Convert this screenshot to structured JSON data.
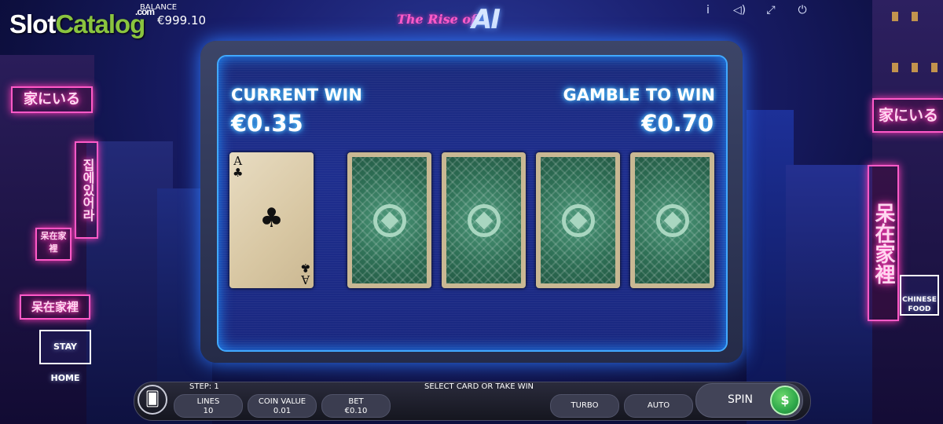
{
  "watermark": {
    "brand_slot": "Slot",
    "brand_catalog": "Catalog",
    "brand_com": ".com"
  },
  "balance": {
    "label": "BALANCE",
    "value": "€999.10"
  },
  "title": {
    "line1": "The Rise of",
    "line2": "AI"
  },
  "top_icons": [
    {
      "name": "info-icon",
      "glyph": "i"
    },
    {
      "name": "sound-icon",
      "glyph": "◁)"
    },
    {
      "name": "fullscreen-icon",
      "glyph": "⤢"
    },
    {
      "name": "power-icon",
      "glyph": "⏻"
    }
  ],
  "gamble": {
    "current_win_label": "CURRENT WIN",
    "current_win_value": "€0.35",
    "gamble_to_win_label": "GAMBLE TO WIN",
    "gamble_to_win_value": "€0.70",
    "cards": [
      {
        "state": "face-up",
        "rank": "A",
        "suit": "♣"
      },
      {
        "state": "face-down"
      },
      {
        "state": "face-down"
      },
      {
        "state": "face-down"
      },
      {
        "state": "face-down"
      }
    ]
  },
  "bottom_bar": {
    "step": "STEP: 1",
    "status": "SELECT CARD OR TAKE WIN",
    "lines_label": "LINES",
    "lines_value": "10",
    "coin_value_label": "COIN VALUE",
    "coin_value_value": "0.01",
    "bet_label": "BET",
    "bet_value": "€0.10",
    "turbo_label": "TURBO",
    "auto_label": "AUTO",
    "spin_label": "SPIN"
  },
  "signs": {
    "left_top": "家にいる",
    "left_vertical": "집에있어라",
    "left_small": "呆在家裡",
    "left_bottom": "呆在家裡",
    "stay_home": "STAY HOME",
    "right_top": "家にいる",
    "right_vertical": "呆在家裡",
    "chinese_food": "CHINESE FOOD"
  },
  "colors": {
    "neon_pink": "#ff3cb4",
    "neon_blue": "#2a9cff",
    "spin_green": "#2ea84a"
  }
}
